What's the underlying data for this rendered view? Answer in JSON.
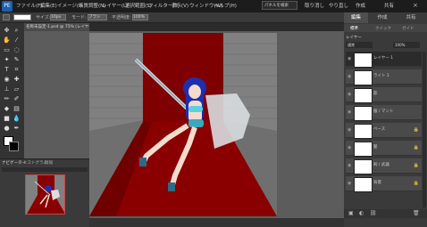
{
  "app": {
    "logo_text": "PE"
  },
  "menu": [
    "ファイル(F)",
    "編集(E)",
    "イメージ(I)",
    "画質調整(N)",
    "レイヤー(L)",
    "選択範囲(S)",
    "フィルター(T)",
    "表示(V)",
    "ウィンドウ(W)",
    "ヘルプ(H)"
  ],
  "toolbar_right": {
    "search": "パネルを検索",
    "undo": "取り消し",
    "redo": "やり直し",
    "create": "作成",
    "share": "共有"
  },
  "options": {
    "size_label": "サイズ:",
    "size_value": "10px",
    "mode_label": "モード:",
    "mode_value": "ブラシ",
    "opacity_label": "不透明度:",
    "opacity_value": "100%"
  },
  "document": {
    "tab_title": "名称未設定-1.psd @ 75% (レイヤー 1, RGB/8) *"
  },
  "right_tabs": [
    "編集",
    "作成",
    "共有"
  ],
  "sub_tabs": [
    "標準",
    "クイック",
    "ガイド"
  ],
  "layers_panel": {
    "title": "レイヤー",
    "mode": "通常",
    "opacity": "100%"
  },
  "layers": [
    {
      "name": "レイヤー 1",
      "selected": true
    },
    {
      "name": "ライト 1"
    },
    {
      "name": "影"
    },
    {
      "name": "服 / マント"
    },
    {
      "name": "ベース"
    },
    {
      "name": "髪"
    },
    {
      "name": "剣 / 武器"
    },
    {
      "name": "背景"
    }
  ],
  "navigator": {
    "tabs": [
      "ナビゲーター",
      "ヒストグラム",
      "情報"
    ]
  },
  "colors": {
    "accent": "#1b5fb0",
    "carpet": "#8a0000",
    "hair": "#1f2fb0",
    "armor": "#5ad0e0"
  }
}
